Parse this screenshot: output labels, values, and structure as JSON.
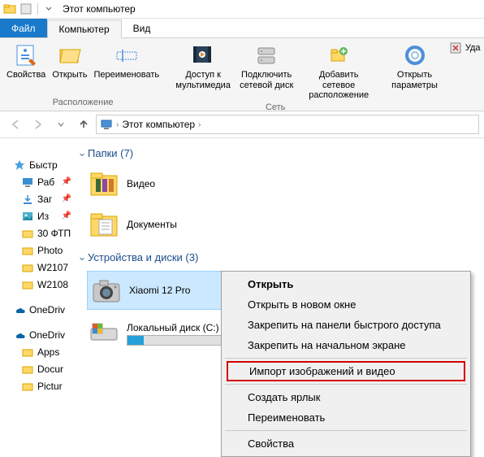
{
  "window": {
    "title": "Этот компьютер"
  },
  "tabs": {
    "file": "Файл",
    "computer": "Компьютер",
    "view": "Вид"
  },
  "ribbon": {
    "properties": "Свойства",
    "open": "Открыть",
    "rename": "Переименовать",
    "group_location": "Расположение",
    "media_access": "Доступ к\nмультимедиа",
    "map_drive": "Подключить\nсетевой диск",
    "add_net": "Добавить сетевое\nрасположение",
    "group_network": "Сеть",
    "open_settings": "Открыть\nпараметры",
    "uninstall": "Уда",
    "group_system": ""
  },
  "address": {
    "root": "Этот компьютер"
  },
  "sidebar": {
    "quick": "Быстр",
    "items": [
      {
        "label": "Раб",
        "pin": true
      },
      {
        "label": "Заг",
        "pin": true
      },
      {
        "label": "Из",
        "pin": true
      },
      {
        "label": "30 ФТП",
        "pin": false
      },
      {
        "label": "Photo",
        "pin": false
      },
      {
        "label": "W2107",
        "pin": false
      },
      {
        "label": "W2108",
        "pin": false
      }
    ],
    "onedrive1": "OneDriv",
    "onedrive2": "OneDriv",
    "od_items": [
      "Apps",
      "Docur",
      "Pictur"
    ]
  },
  "content": {
    "folders_hdr": "Папки (7)",
    "folders": [
      {
        "label": "Видео"
      },
      {
        "label": "Документы"
      }
    ],
    "devices_hdr": "Устройства и диски (3)",
    "devices": [
      {
        "label": "Xiaomi 12 Pro"
      },
      {
        "label": "Локальный диск (C:)"
      }
    ]
  },
  "ctx": {
    "open": "Открыть",
    "open_new": "Открыть в новом окне",
    "pin_quick": "Закрепить на панели быстрого доступа",
    "pin_start": "Закрепить на начальном экране",
    "import": "Импорт изображений и видео",
    "shortcut": "Создать ярлык",
    "rename": "Переименовать",
    "props": "Свойства"
  }
}
